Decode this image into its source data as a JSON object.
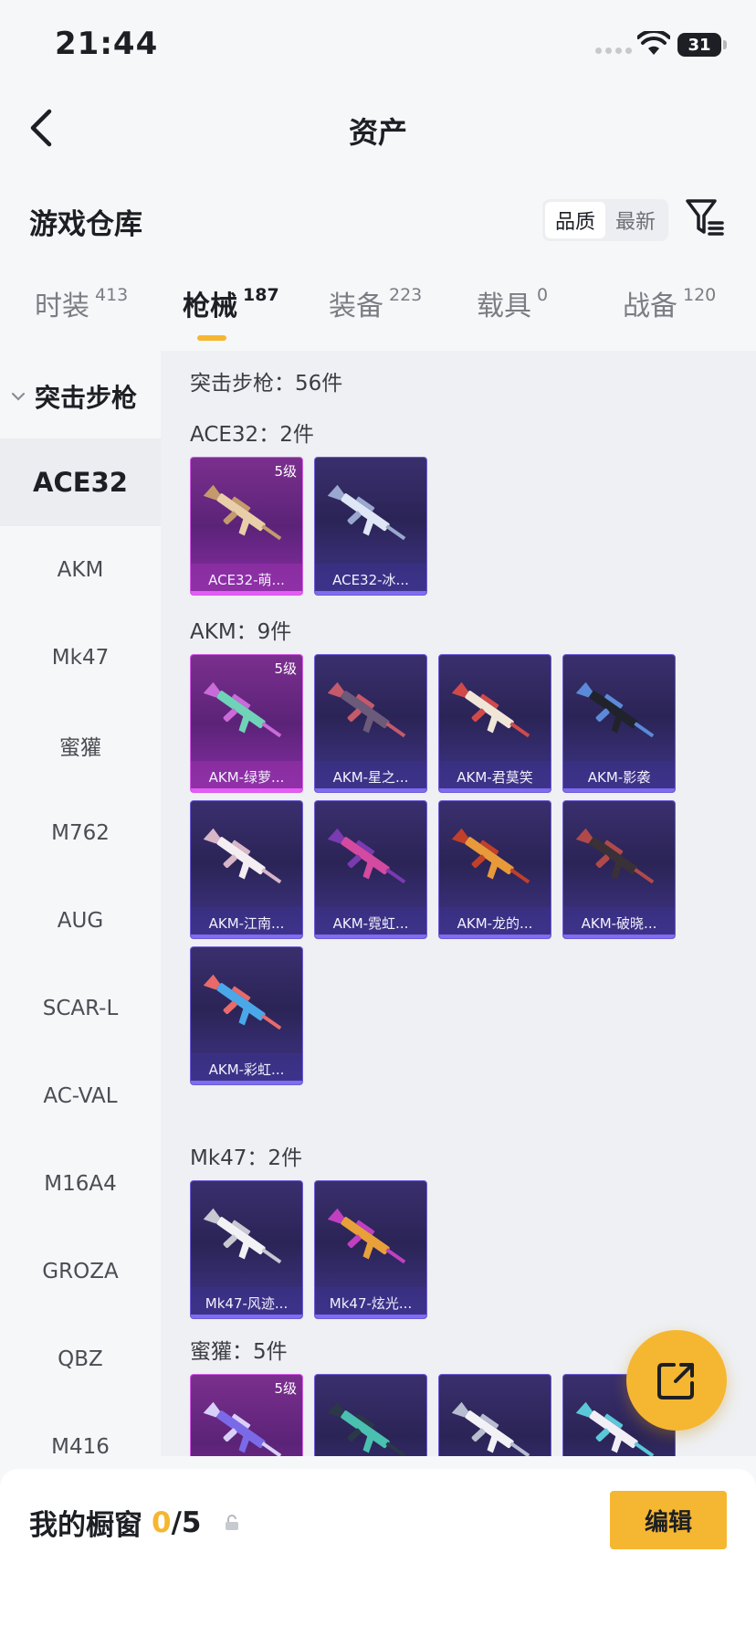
{
  "status_bar": {
    "time": "21:44",
    "battery": "31"
  },
  "nav": {
    "title": "资产"
  },
  "header": {
    "section_title": "游戏仓库",
    "sort_options": [
      "品质",
      "最新"
    ]
  },
  "tabs": [
    {
      "label": "时装",
      "count": "413"
    },
    {
      "label": "枪械",
      "count": "187"
    },
    {
      "label": "装备",
      "count": "223"
    },
    {
      "label": "载具",
      "count": "0"
    },
    {
      "label": "战备",
      "count": "120"
    }
  ],
  "sidebar": {
    "group": "突击步枪",
    "items": [
      "ACE32",
      "AKM",
      "Mk47",
      "蜜獾",
      "M762",
      "AUG",
      "SCAR-L",
      "AC-VAL",
      "M16A4",
      "GROZA",
      "QBZ",
      "M416"
    ]
  },
  "content": {
    "summary": "突击步枪：56件",
    "groups": [
      {
        "title": "ACE32：2件",
        "cards": [
          {
            "name": "ACE32-萌...",
            "level": "5级",
            "rarity": "gold",
            "skin": [
              "#e8cfa8",
              "#c49a6c"
            ]
          },
          {
            "name": "ACE32-冰...",
            "level": "",
            "rarity": "purple",
            "skin": [
              "#dfe6f5",
              "#9aa8cf"
            ]
          }
        ]
      },
      {
        "title": "AKM：9件",
        "cards": [
          {
            "name": "AKM-绿萝...",
            "level": "5级",
            "rarity": "gold",
            "skin": [
              "#6fd3b8",
              "#c96bd8"
            ]
          },
          {
            "name": "AKM-星之...",
            "level": "",
            "rarity": "purple",
            "skin": [
              "#6b5a7a",
              "#c45a6a"
            ]
          },
          {
            "name": "AKM-君莫笑",
            "level": "",
            "rarity": "purple",
            "skin": [
              "#f0e6d8",
              "#d04a4a"
            ]
          },
          {
            "name": "AKM-影袭",
            "level": "",
            "rarity": "purple",
            "skin": [
              "#20232b",
              "#5a8ad8"
            ]
          },
          {
            "name": "AKM-江南...",
            "level": "",
            "rarity": "purple",
            "skin": [
              "#f4eef2",
              "#d8b6c8"
            ]
          },
          {
            "name": "AKM-霓虹...",
            "level": "",
            "rarity": "purple",
            "skin": [
              "#d34aa0",
              "#7a3ab0"
            ]
          },
          {
            "name": "AKM-龙的...",
            "level": "",
            "rarity": "purple",
            "skin": [
              "#e89a3a",
              "#c0402a"
            ]
          },
          {
            "name": "AKM-破晓...",
            "level": "",
            "rarity": "purple",
            "skin": [
              "#3a3038",
              "#b04a4a"
            ]
          },
          {
            "name": "AKM-彩虹...",
            "level": "",
            "rarity": "purple",
            "skin": [
              "#4aa8e8",
              "#e86a6a"
            ]
          }
        ]
      },
      {
        "title": "Mk47：2件",
        "cards": [
          {
            "name": "Mk47-风迹...",
            "level": "",
            "rarity": "purple",
            "skin": [
              "#f2f2f6",
              "#c8c8d2"
            ]
          },
          {
            "name": "Mk47-炫光...",
            "level": "",
            "rarity": "purple",
            "skin": [
              "#e8a03a",
              "#c040c0"
            ]
          }
        ]
      },
      {
        "title": "蜜獾：5件",
        "cards": [
          {
            "name": "",
            "level": "5级",
            "rarity": "gold",
            "skin": [
              "#7a6ae8",
              "#d8d0f8"
            ]
          },
          {
            "name": "",
            "level": "",
            "rarity": "purple",
            "skin": [
              "#4ac0b0",
              "#2a3848"
            ]
          },
          {
            "name": "",
            "level": "",
            "rarity": "purple",
            "skin": [
              "#f2f2f6",
              "#b8bcd0"
            ]
          },
          {
            "name": "",
            "level": "",
            "rarity": "purple",
            "skin": [
              "#f2eef6",
              "#5ac8d8"
            ]
          }
        ]
      }
    ]
  },
  "bottom_bar": {
    "label": "我的橱窗",
    "count": "0",
    "total": "/5",
    "edit_label": "编辑"
  },
  "colors": {
    "accent": "#f5b731",
    "gold_card": "#8a2ea7",
    "purple_card": "#3f368a"
  }
}
